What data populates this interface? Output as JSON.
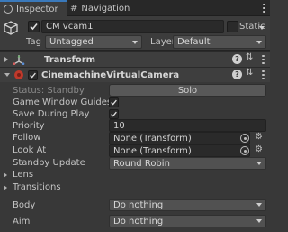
{
  "tabs": [
    {
      "label": "Inspector",
      "icon": "info-icon"
    },
    {
      "label": "Navigation",
      "icon": "hash-icon"
    }
  ],
  "object": {
    "name": "CM vcam1",
    "static_label": "Static",
    "tag_label": "Tag",
    "tag_value": "Untagged",
    "layer_label": "Layer",
    "layer_value": "Default"
  },
  "components": {
    "transform": {
      "title": "Transform"
    },
    "vcam": {
      "title": "CinemachineVirtualCamera"
    }
  },
  "fields": {
    "status_label": "Status: Standby",
    "solo_label": "Solo",
    "game_window_guides_label": "Game Window Guides",
    "save_during_play_label": "Save During Play",
    "priority_label": "Priority",
    "priority_value": "10",
    "follow_label": "Follow",
    "follow_value": "None (Transform)",
    "look_at_label": "Look At",
    "look_at_value": "None (Transform)",
    "standby_update_label": "Standby Update",
    "standby_update_value": "Round Robin",
    "lens_label": "Lens",
    "transitions_label": "Transitions",
    "body_label": "Body",
    "body_value": "Do nothing",
    "aim_label": "Aim",
    "aim_value": "Do nothing"
  },
  "colors": {
    "accent": "#3a79bb",
    "background": "#383838",
    "field": "#2a2a2a"
  }
}
